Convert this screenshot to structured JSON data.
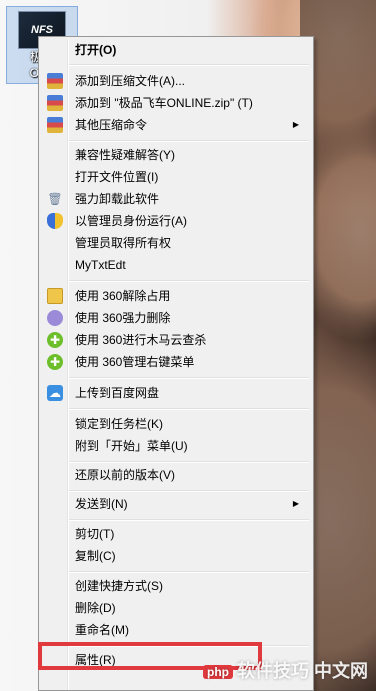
{
  "desktop_icon": {
    "label_line1": "极品",
    "label_line2": "ONL",
    "thumb_text": "NFS"
  },
  "menu": {
    "items": [
      {
        "label": "打开(O)",
        "icon": "none"
      },
      {
        "label": "添加到压缩文件(A)...",
        "icon": "archive-icon"
      },
      {
        "label": "添加到 \"极品飞车ONLINE.zip\" (T)",
        "icon": "archive-icon"
      },
      {
        "label": "其他压缩命令",
        "icon": "archive-icon",
        "submenu": true
      },
      {
        "label": "兼容性疑难解答(Y)",
        "icon": "none"
      },
      {
        "label": "打开文件位置(I)",
        "icon": "none"
      },
      {
        "label": "强力卸载此软件",
        "icon": "trash-icon"
      },
      {
        "label": "以管理员身份运行(A)",
        "icon": "shield-icon"
      },
      {
        "label": "管理员取得所有权",
        "icon": "none"
      },
      {
        "label": "MyTxtEdt",
        "icon": "none"
      },
      {
        "label": "使用 360解除占用",
        "icon": "folder-icon"
      },
      {
        "label": "使用 360强力删除",
        "icon": "360-delete-icon"
      },
      {
        "label": "使用 360进行木马云查杀",
        "icon": "360-icon"
      },
      {
        "label": "使用 360管理右键菜单",
        "icon": "360-icon"
      },
      {
        "label": "上传到百度网盘",
        "icon": "cloud-icon"
      },
      {
        "label": "锁定到任务栏(K)",
        "icon": "none"
      },
      {
        "label": "附到「开始」菜单(U)",
        "icon": "none"
      },
      {
        "label": "还原以前的版本(V)",
        "icon": "none"
      },
      {
        "label": "发送到(N)",
        "icon": "none",
        "submenu": true
      },
      {
        "label": "剪切(T)",
        "icon": "none"
      },
      {
        "label": "复制(C)",
        "icon": "none"
      },
      {
        "label": "创建快捷方式(S)",
        "icon": "none"
      },
      {
        "label": "删除(D)",
        "icon": "none"
      },
      {
        "label": "重命名(M)",
        "icon": "none"
      },
      {
        "label": "属性(R)",
        "icon": "none"
      }
    ]
  },
  "watermark": {
    "logo": "php",
    "text": "软件技巧 中文网"
  },
  "colors": {
    "highlight_border": "#e0393e",
    "menu_bg": "#f0f0f0"
  }
}
